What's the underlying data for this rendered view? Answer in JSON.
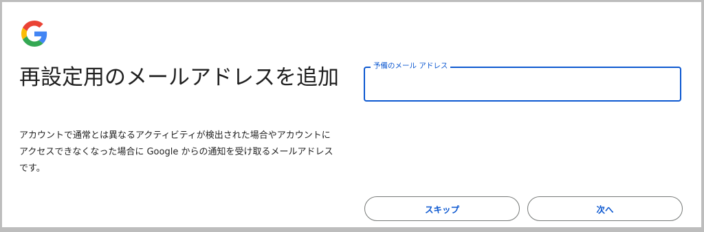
{
  "logo": {
    "icon": "google-g-icon",
    "colors": [
      "#4285F4",
      "#EA4335",
      "#FBBC05",
      "#34A853"
    ]
  },
  "heading": "再設定用のメールアドレスを追加",
  "description": "アカウントで通常とは異なるアクティビティが検出された場合やアカウントにアクセスできなくなった場合に Google からの通知を受け取るメールアドレスです。",
  "email_field": {
    "label": "予備のメール アドレス",
    "value": ""
  },
  "buttons": {
    "skip": "スキップ",
    "next": "次へ"
  },
  "colors": {
    "accent": "#0b57d0",
    "text": "#1f1f1f",
    "border": "#747775"
  }
}
